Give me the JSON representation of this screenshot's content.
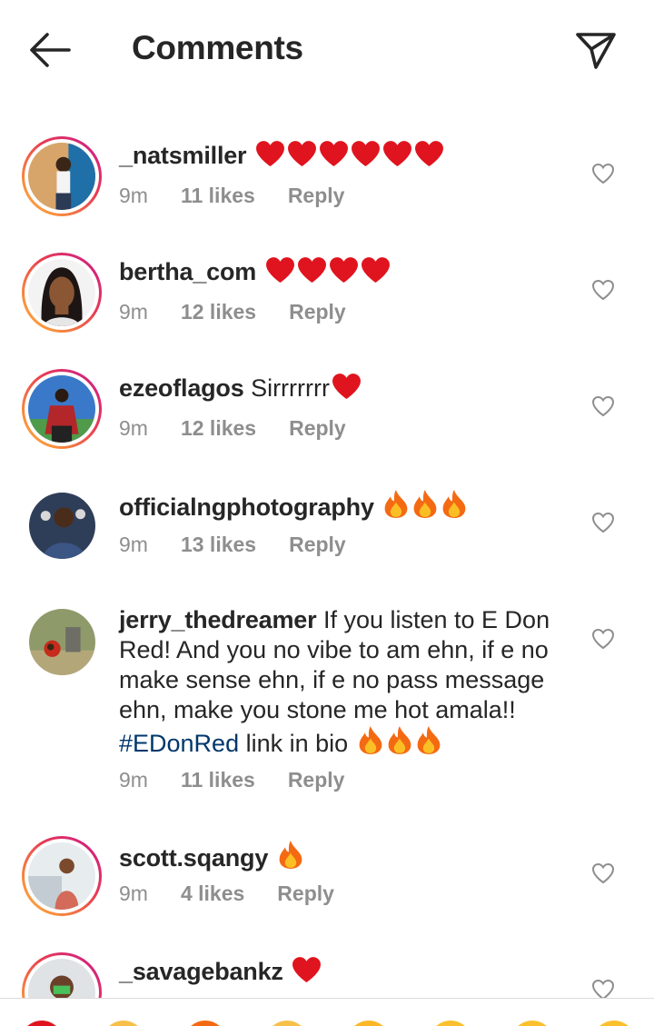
{
  "header": {
    "title": "Comments",
    "back_icon": "arrow-left-icon",
    "share_icon": "paper-plane-icon"
  },
  "comments": [
    {
      "username": "_natsmiller",
      "text": "",
      "emoji": "heart",
      "emoji_count": 6,
      "time": "9m",
      "likes": "11 likes",
      "reply": "Reply",
      "story_ring": true
    },
    {
      "username": "bertha_com",
      "text": "",
      "emoji": "heart",
      "emoji_count": 4,
      "time": "9m",
      "likes": "12 likes",
      "reply": "Reply",
      "story_ring": true
    },
    {
      "username": "ezeoflagos",
      "text": "Sirrrrrrr",
      "emoji": "heart",
      "emoji_count": 1,
      "time": "9m",
      "likes": "12 likes",
      "reply": "Reply",
      "story_ring": true
    },
    {
      "username": "officialngphotography",
      "text": "",
      "emoji": "fire",
      "emoji_count": 3,
      "time": "9m",
      "likes": "13 likes",
      "reply": "Reply",
      "story_ring": false
    },
    {
      "username": "jerry_thedreamer",
      "text": "If you listen to E Don Red! And you no vibe to am ehn, if e no make sense ehn, if e no pass message ehn, make you stone me hot amala!!",
      "hashtag": "#EDonRed",
      "text_after": "link in bio",
      "emoji": "fire",
      "emoji_count": 3,
      "time": "9m",
      "likes": "11 likes",
      "reply": "Reply",
      "story_ring": false
    },
    {
      "username": "scott.sqangy",
      "text": "",
      "emoji": "fire",
      "emoji_count": 1,
      "time": "9m",
      "likes": "4 likes",
      "reply": "Reply",
      "story_ring": true
    },
    {
      "username": "_savagebankz",
      "text": "",
      "emoji": "heart",
      "emoji_count": 1,
      "story_ring": true
    }
  ],
  "colors": {
    "heart": "#e0141e",
    "hashtag": "#00376b",
    "meta": "#8e8e8e",
    "text": "#262626"
  },
  "icons": {
    "like": "heart-outline-icon"
  }
}
